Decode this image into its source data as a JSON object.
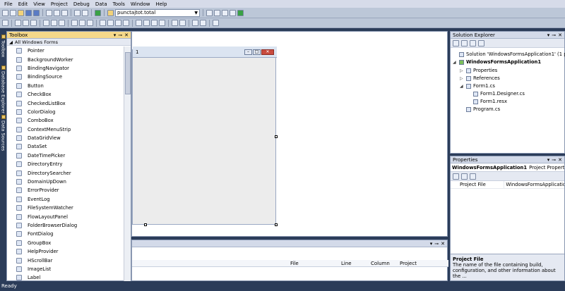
{
  "menu": [
    "File",
    "Edit",
    "View",
    "Project",
    "Debug",
    "Data",
    "Tools",
    "Window",
    "Help"
  ],
  "toolbar": {
    "config_combo_value": "punctajtot.total"
  },
  "side_tabs": [
    "Toolbox",
    "Database Explorer",
    "Data Sources"
  ],
  "toolbox": {
    "title": "Toolbox",
    "group_label": "All Windows Forms",
    "items": [
      {
        "label": "Pointer",
        "icon": "pointer-icon"
      },
      {
        "label": "BackgroundWorker",
        "icon": "backgroundworker-icon"
      },
      {
        "label": "BindingNavigator",
        "icon": "bindingnavigator-icon"
      },
      {
        "label": "BindingSource",
        "icon": "bindingsource-icon"
      },
      {
        "label": "Button",
        "icon": "button-icon"
      },
      {
        "label": "CheckBox",
        "icon": "checkbox-icon"
      },
      {
        "label": "CheckedListBox",
        "icon": "checkedlistbox-icon"
      },
      {
        "label": "ColorDialog",
        "icon": "colordialog-icon"
      },
      {
        "label": "ComboBox",
        "icon": "combobox-icon"
      },
      {
        "label": "ContextMenuStrip",
        "icon": "contextmenustrip-icon"
      },
      {
        "label": "DataGridView",
        "icon": "datagridview-icon"
      },
      {
        "label": "DataSet",
        "icon": "dataset-icon"
      },
      {
        "label": "DateTimePicker",
        "icon": "datetimepicker-icon"
      },
      {
        "label": "DirectoryEntry",
        "icon": "directoryentry-icon"
      },
      {
        "label": "DirectorySearcher",
        "icon": "directorysearcher-icon"
      },
      {
        "label": "DomainUpDown",
        "icon": "domainupdown-icon"
      },
      {
        "label": "ErrorProvider",
        "icon": "errorprovider-icon"
      },
      {
        "label": "EventLog",
        "icon": "eventlog-icon"
      },
      {
        "label": "FileSystemWatcher",
        "icon": "filesystemwatcher-icon"
      },
      {
        "label": "FlowLayoutPanel",
        "icon": "flowlayoutpanel-icon"
      },
      {
        "label": "FolderBrowserDialog",
        "icon": "folderbrowserdialog-icon"
      },
      {
        "label": "FontDialog",
        "icon": "fontdialog-icon"
      },
      {
        "label": "GroupBox",
        "icon": "groupbox-icon"
      },
      {
        "label": "HelpProvider",
        "icon": "helpprovider-icon"
      },
      {
        "label": "HScrollBar",
        "icon": "hscrollbar-icon"
      },
      {
        "label": "ImageList",
        "icon": "imagelist-icon"
      },
      {
        "label": "Label",
        "icon": "label-icon"
      }
    ]
  },
  "designer": {
    "form_title": "1"
  },
  "error_list": {
    "columns": [
      "File",
      "Line",
      "Column",
      "Project"
    ]
  },
  "solution_explorer": {
    "title": "Solution Explorer",
    "items": [
      {
        "label": "Solution 'WindowsFormsApplication1' (1 proje",
        "bold": false
      },
      {
        "label": "WindowsFormsApplication1",
        "bold": true
      },
      {
        "label": "Properties",
        "bold": false
      },
      {
        "label": "References",
        "bold": false
      },
      {
        "label": "Form1.cs",
        "bold": false
      },
      {
        "label": "Form1.Designer.cs",
        "bold": false
      },
      {
        "label": "Form1.resx",
        "bold": false
      },
      {
        "label": "Program.cs",
        "bold": false
      }
    ]
  },
  "properties": {
    "title": "Properties",
    "object_name": "WindowsFormsApplication1",
    "object_type": "Project Properties",
    "rows": [
      {
        "name": "Project File",
        "value": "WindowsFormsApplicatio"
      }
    ],
    "desc_title": "Project File",
    "desc_text": "The name of the file containing build, configuration, and other information about the ..."
  },
  "status": {
    "text": "Ready"
  }
}
